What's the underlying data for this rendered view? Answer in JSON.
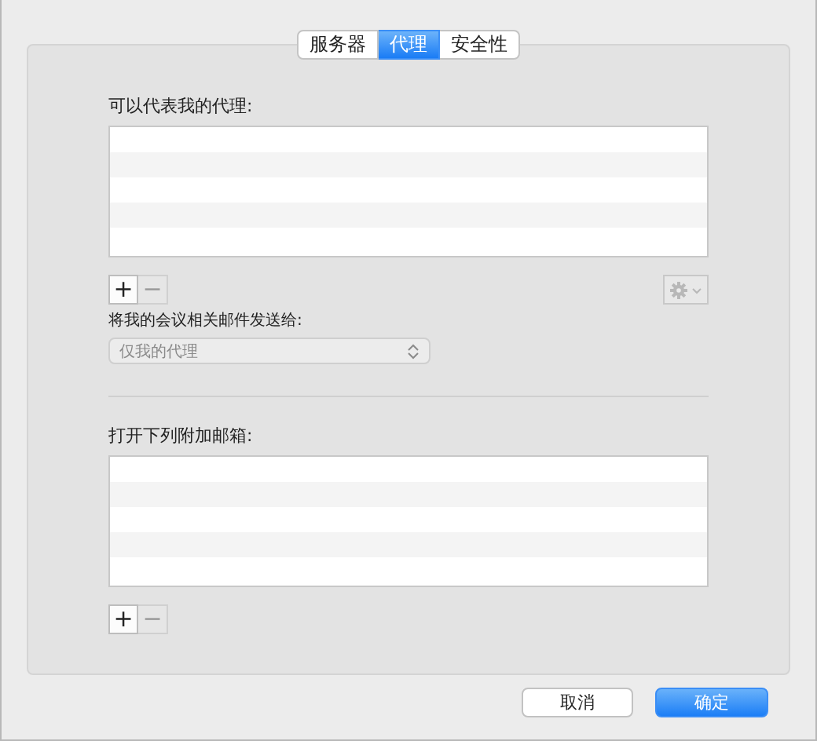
{
  "tabs": [
    {
      "label": "服务器",
      "selected": false
    },
    {
      "label": "代理",
      "selected": true
    },
    {
      "label": "安全性",
      "selected": false
    }
  ],
  "delegates": {
    "label": "可以代表我的代理:",
    "add": {
      "text": "+",
      "disabled": false
    },
    "remove": {
      "text": "−",
      "disabled": true
    },
    "gear_menu": {
      "disabled": true
    }
  },
  "forward": {
    "label": "将我的会议相关邮件发送给:",
    "popup": {
      "value": "仅我的代理",
      "disabled": true
    }
  },
  "mailboxes": {
    "label": "打开下列附加邮箱:",
    "add": {
      "text": "+",
      "disabled": false
    },
    "remove": {
      "text": "−",
      "disabled": true
    }
  },
  "buttons": [
    {
      "label": "取消",
      "kind": "default"
    },
    {
      "label": "确定",
      "kind": "primary"
    }
  ]
}
